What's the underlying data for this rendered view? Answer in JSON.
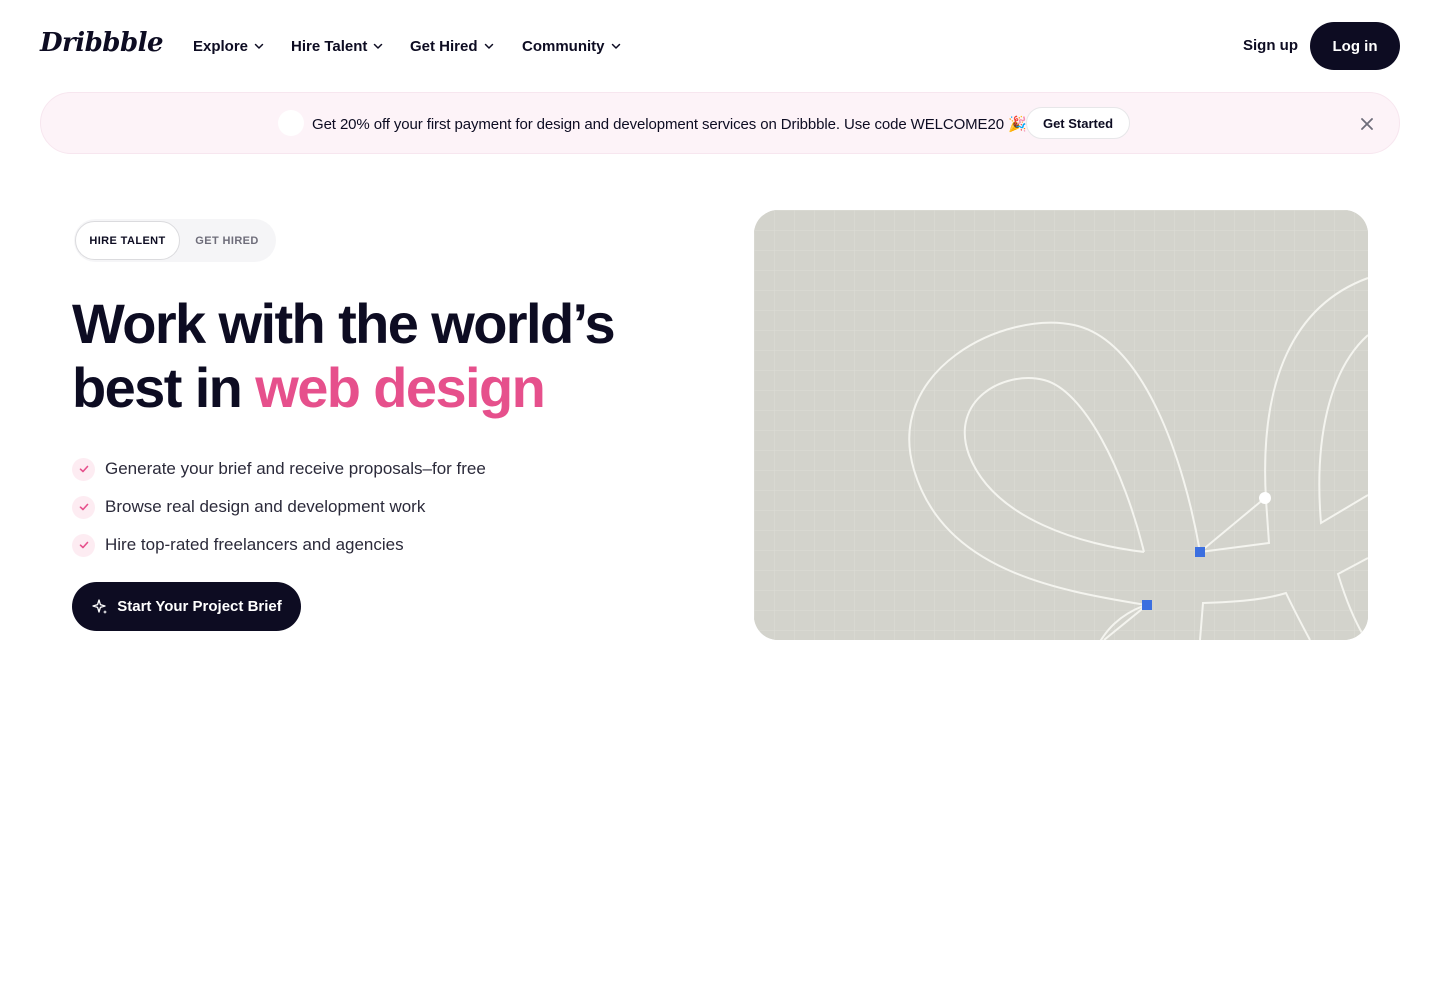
{
  "header": {
    "logo_text": "Dribbble",
    "nav": [
      {
        "label": "Explore"
      },
      {
        "label": "Hire Talent"
      },
      {
        "label": "Get Hired"
      },
      {
        "label": "Community"
      }
    ],
    "signup_label": "Sign up",
    "login_label": "Log in"
  },
  "promo": {
    "text": "Get 20% off your first payment for design and development services on Dribbble. Use code WELCOME20 🎉",
    "button_label": "Get Started",
    "background_color": "#fdf3f8"
  },
  "hero": {
    "toggle": {
      "active_label": "HIRE TALENT",
      "inactive_label": "GET HIRED"
    },
    "headline_line1": "Work with the world’s",
    "headline_line2_prefix": "best in ",
    "headline_accent": "web design",
    "features": [
      "Generate your brief and receive proposals–for free",
      "Browse real design and development work",
      "Hire top-rated freelancers and agencies"
    ],
    "cta_label": "Start Your Project Brief"
  },
  "colors": {
    "primary_dark": "#0d0c22",
    "accent_pink": "#e6508c",
    "illustration_bg": "#d3d3cc",
    "anchor_blue": "#3b6fe0"
  }
}
